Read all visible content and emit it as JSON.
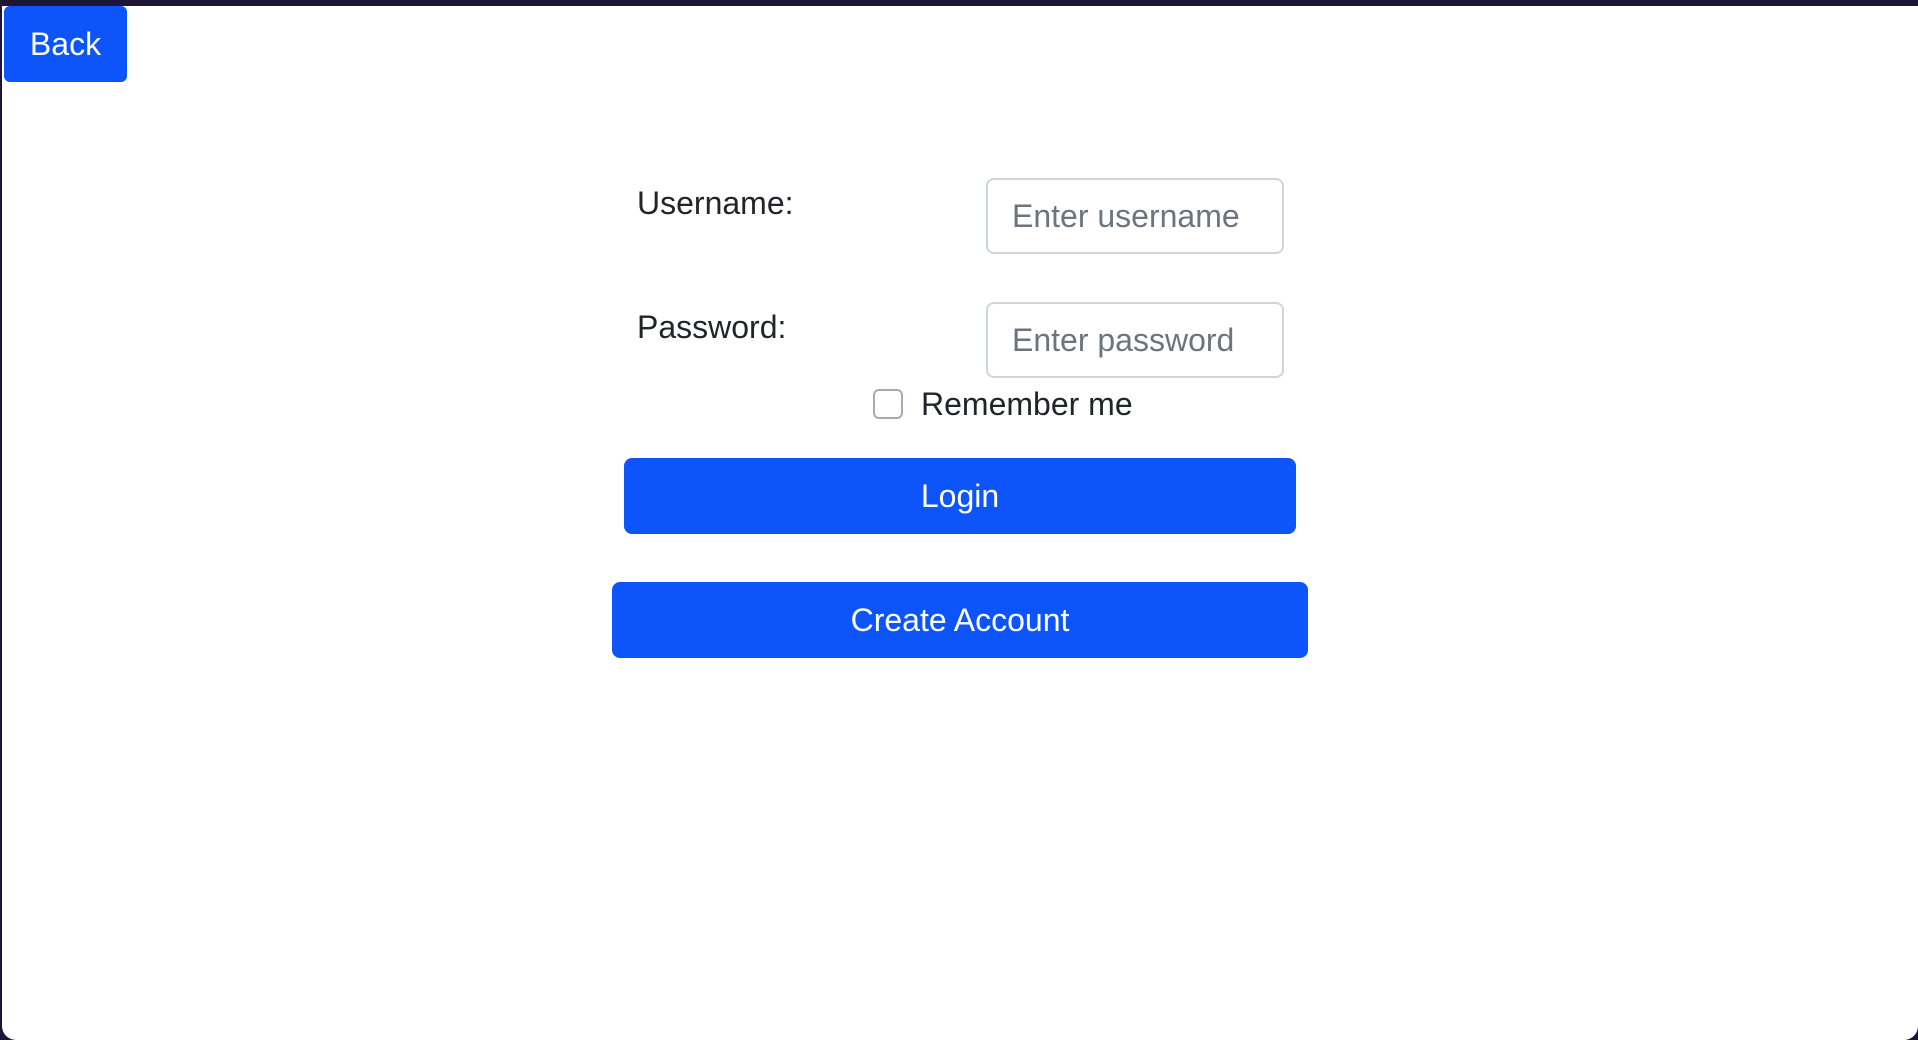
{
  "nav": {
    "back_label": "Back"
  },
  "login_form": {
    "username_label": "Username:",
    "username_value": "",
    "username_placeholder": "Enter username",
    "password_label": "Password:",
    "password_value": "",
    "password_placeholder": "Enter password",
    "remember_label": "Remember me",
    "remember_checked": false,
    "login_label": "Login",
    "create_account_label": "Create Account"
  },
  "colors": {
    "accent": "#0d55fb",
    "window_frame": "#1d1537",
    "text": "#212529",
    "placeholder": "#6c757d",
    "input_border": "#ced4da"
  }
}
